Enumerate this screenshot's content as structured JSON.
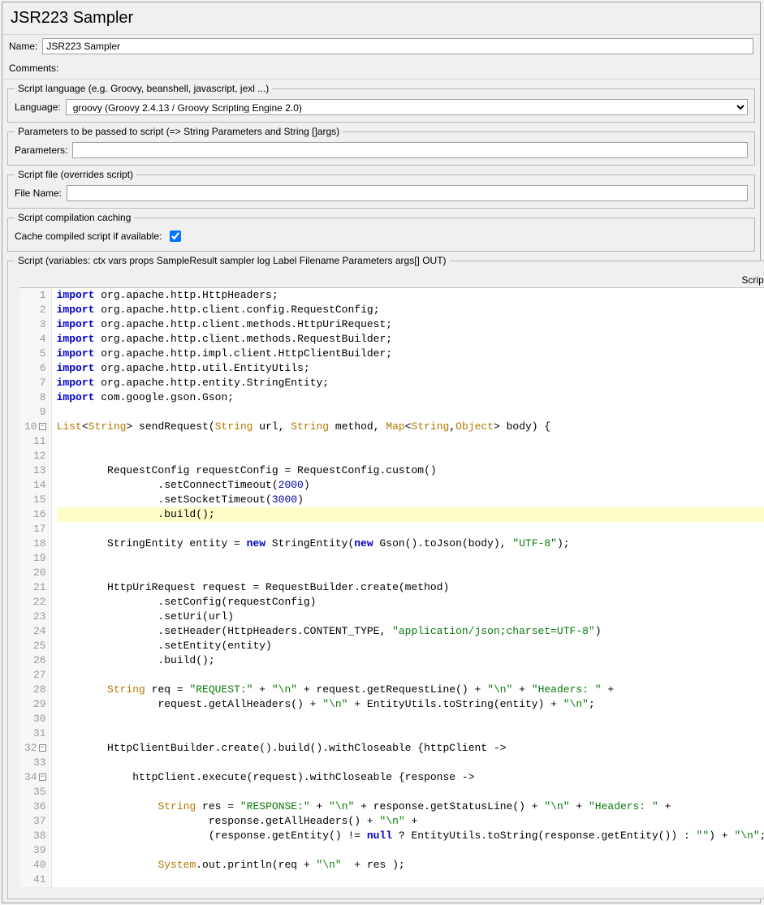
{
  "window": {
    "title": "JSR223 Sampler"
  },
  "fields": {
    "name_label": "Name:",
    "name_value": "JSR223 Sampler",
    "comments_label": "Comments:"
  },
  "language_group": {
    "legend": "Script language (e.g. Groovy, beanshell, javascript, jexl ...)",
    "label": "Language:",
    "value": "groovy     (Groovy 2.4.13 / Groovy Scripting Engine 2.0)"
  },
  "params_group": {
    "legend": "Parameters to be passed to script (=> String Parameters and String []args)",
    "label": "Parameters:",
    "value": ""
  },
  "file_group": {
    "legend": "Script file (overrides script)",
    "label": "File Name:",
    "value": ""
  },
  "cache_group": {
    "legend": "Script compilation caching",
    "label": "Cache compiled script if available:",
    "checked": true
  },
  "script_group": {
    "legend": "Script (variables: ctx vars props SampleResult sampler log Label Filename Parameters args[] OUT)",
    "script_label": "Script:"
  },
  "code_lines": [
    {
      "n": 1,
      "html": "<span class='kw'>import</span> org.apache.http.HttpHeaders<span class='pn'>;</span>"
    },
    {
      "n": 2,
      "html": "<span class='kw'>import</span> org.apache.http.client.config.RequestConfig<span class='pn'>;</span>"
    },
    {
      "n": 3,
      "html": "<span class='kw'>import</span> org.apache.http.client.methods.HttpUriRequest<span class='pn'>;</span>"
    },
    {
      "n": 4,
      "html": "<span class='kw'>import</span> org.apache.http.client.methods.RequestBuilder<span class='pn'>;</span>"
    },
    {
      "n": 5,
      "html": "<span class='kw'>import</span> org.apache.http.impl.client.HttpClientBuilder<span class='pn'>;</span>"
    },
    {
      "n": 6,
      "html": "<span class='kw'>import</span> org.apache.http.util.EntityUtils<span class='pn'>;</span>"
    },
    {
      "n": 7,
      "html": "<span class='kw'>import</span> org.apache.http.entity.StringEntity<span class='pn'>;</span>"
    },
    {
      "n": 8,
      "html": "<span class='kw'>import</span> com.google.gson.Gson<span class='pn'>;</span>"
    },
    {
      "n": 9,
      "html": ""
    },
    {
      "n": 10,
      "fold": true,
      "html": "<span class='cls'>List</span>&lt;<span class='cls'>String</span>&gt; sendRequest(<span class='cls'>String</span> url, <span class='cls'>String</span> method, <span class='cls'>Map</span>&lt;<span class='cls'>String</span>,<span class='cls'>Object</span>&gt; body) <span class='pn'>{</span>"
    },
    {
      "n": 11,
      "html": ""
    },
    {
      "n": 12,
      "html": ""
    },
    {
      "n": 13,
      "html": "        RequestConfig requestConfig = RequestConfig.custom()"
    },
    {
      "n": 14,
      "html": "                .setConnectTimeout(<span class='num'>2000</span>)"
    },
    {
      "n": 15,
      "html": "                .setSocketTimeout(<span class='num'>3000</span>)"
    },
    {
      "n": 16,
      "hl": true,
      "html": "                .build();"
    },
    {
      "n": 17,
      "html": ""
    },
    {
      "n": 18,
      "html": "        StringEntity entity = <span class='kw'>new</span> StringEntity(<span class='kw'>new</span> Gson().toJson(body), <span class='str'>\"UTF-8\"</span>);"
    },
    {
      "n": 19,
      "html": ""
    },
    {
      "n": 20,
      "html": ""
    },
    {
      "n": 21,
      "html": "        HttpUriRequest request = RequestBuilder.create(method)"
    },
    {
      "n": 22,
      "html": "                .setConfig(requestConfig)"
    },
    {
      "n": 23,
      "html": "                .setUri(url)"
    },
    {
      "n": 24,
      "html": "                .setHeader(HttpHeaders.CONTENT_TYPE, <span class='str'>\"application/json;charset=UTF-8\"</span>)"
    },
    {
      "n": 25,
      "html": "                .setEntity(entity)"
    },
    {
      "n": 26,
      "html": "                .build();"
    },
    {
      "n": 27,
      "html": ""
    },
    {
      "n": 28,
      "html": "        <span class='cls'>String</span> req = <span class='str'>\"REQUEST:\"</span> + <span class='str'>\"\\n\"</span> + request.getRequestLine() + <span class='str'>\"\\n\"</span> + <span class='str'>\"Headers: \"</span> +"
    },
    {
      "n": 29,
      "html": "                request.getAllHeaders() + <span class='str'>\"\\n\"</span> + EntityUtils.toString(entity) + <span class='str'>\"\\n\"</span>;"
    },
    {
      "n": 30,
      "html": ""
    },
    {
      "n": 31,
      "html": ""
    },
    {
      "n": 32,
      "fold": true,
      "html": "        HttpClientBuilder.create().build().withCloseable {httpClient -&gt;"
    },
    {
      "n": 33,
      "html": ""
    },
    {
      "n": 34,
      "fold": true,
      "html": "            httpClient.execute(request).withCloseable {response -&gt;"
    },
    {
      "n": 35,
      "html": ""
    },
    {
      "n": 36,
      "html": "                <span class='cls'>String</span> res = <span class='str'>\"RESPONSE:\"</span> + <span class='str'>\"\\n\"</span> + response.getStatusLine() + <span class='str'>\"\\n\"</span> + <span class='str'>\"Headers: \"</span> +"
    },
    {
      "n": 37,
      "html": "                        response.getAllHeaders() + <span class='str'>\"\\n\"</span> +"
    },
    {
      "n": 38,
      "html": "                        (response.getEntity() != <span class='kw'>null</span> ? EntityUtils.toString(response.getEntity()) : <span class='str'>\"\"</span>) + <span class='str'>\"\\n\"</span>;"
    },
    {
      "n": 39,
      "html": ""
    },
    {
      "n": 40,
      "html": "                <span class='cls'>System</span>.out.println(req + <span class='str'>\"\\n\"</span>  + res );"
    },
    {
      "n": 41,
      "html": ""
    }
  ]
}
